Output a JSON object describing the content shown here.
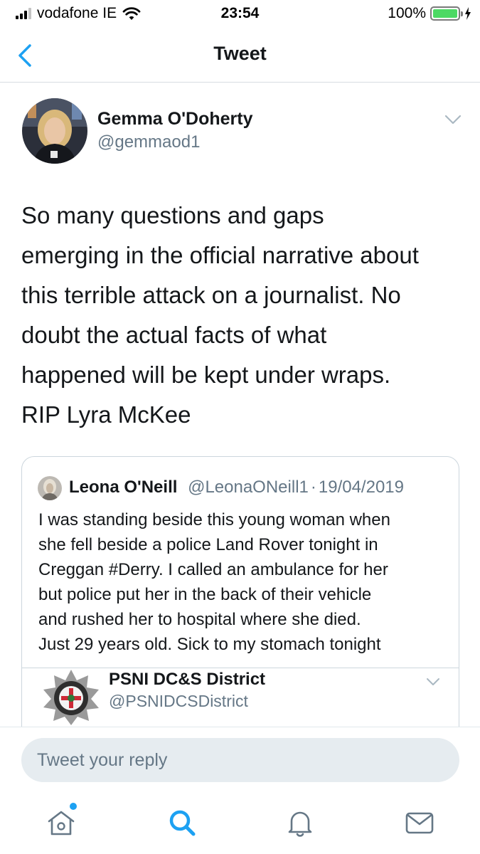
{
  "status_bar": {
    "carrier": "vodafone IE",
    "time": "23:54",
    "battery": "100%",
    "battery_level": 1.0,
    "signal_bars_active": 3,
    "signal_bars_total": 4
  },
  "nav": {
    "title": "Tweet",
    "back_icon": "chevron-left-icon"
  },
  "tweet": {
    "author_name": "Gemma O'Doherty",
    "author_handle": "@gemmaod1",
    "text_lines": [
      "So many questions and gaps",
      "emerging in the official narrative about",
      "this terrible attack on a journalist. No",
      "doubt the actual facts of what",
      "happened will be kept under wraps.",
      "RIP Lyra McKee"
    ]
  },
  "quoted_tweet": {
    "author_name": "Leona O'Neill",
    "author_handle": "@LeonaONeill1",
    "separator": "·",
    "date": "19/04/2019",
    "text_lines": [
      "I was standing beside this young woman when",
      "she fell beside a police Land Rover tonight in",
      "Creggan #Derry. I called an ambulance for her",
      "but police put her in the back of their vehicle",
      "and rushed her to hospital where she died.",
      "Just 29 years old. Sick to my stomach tonight"
    ],
    "embedded": {
      "author_name": "PSNI DC&S District",
      "author_handle": "@PSNIDCSDistrict"
    }
  },
  "reply": {
    "placeholder": "Tweet your reply"
  },
  "tab_bar": {
    "items": [
      "home-icon",
      "search-icon",
      "notifications-icon",
      "messages-icon"
    ],
    "active": "search-icon",
    "home_has_notification": true
  },
  "colors": {
    "accent": "#1da1f2",
    "text": "#14171a",
    "secondary_text": "#657786",
    "border": "#ccd6dd",
    "battery": "#4cd964",
    "input_bg": "#e6ecf0"
  }
}
